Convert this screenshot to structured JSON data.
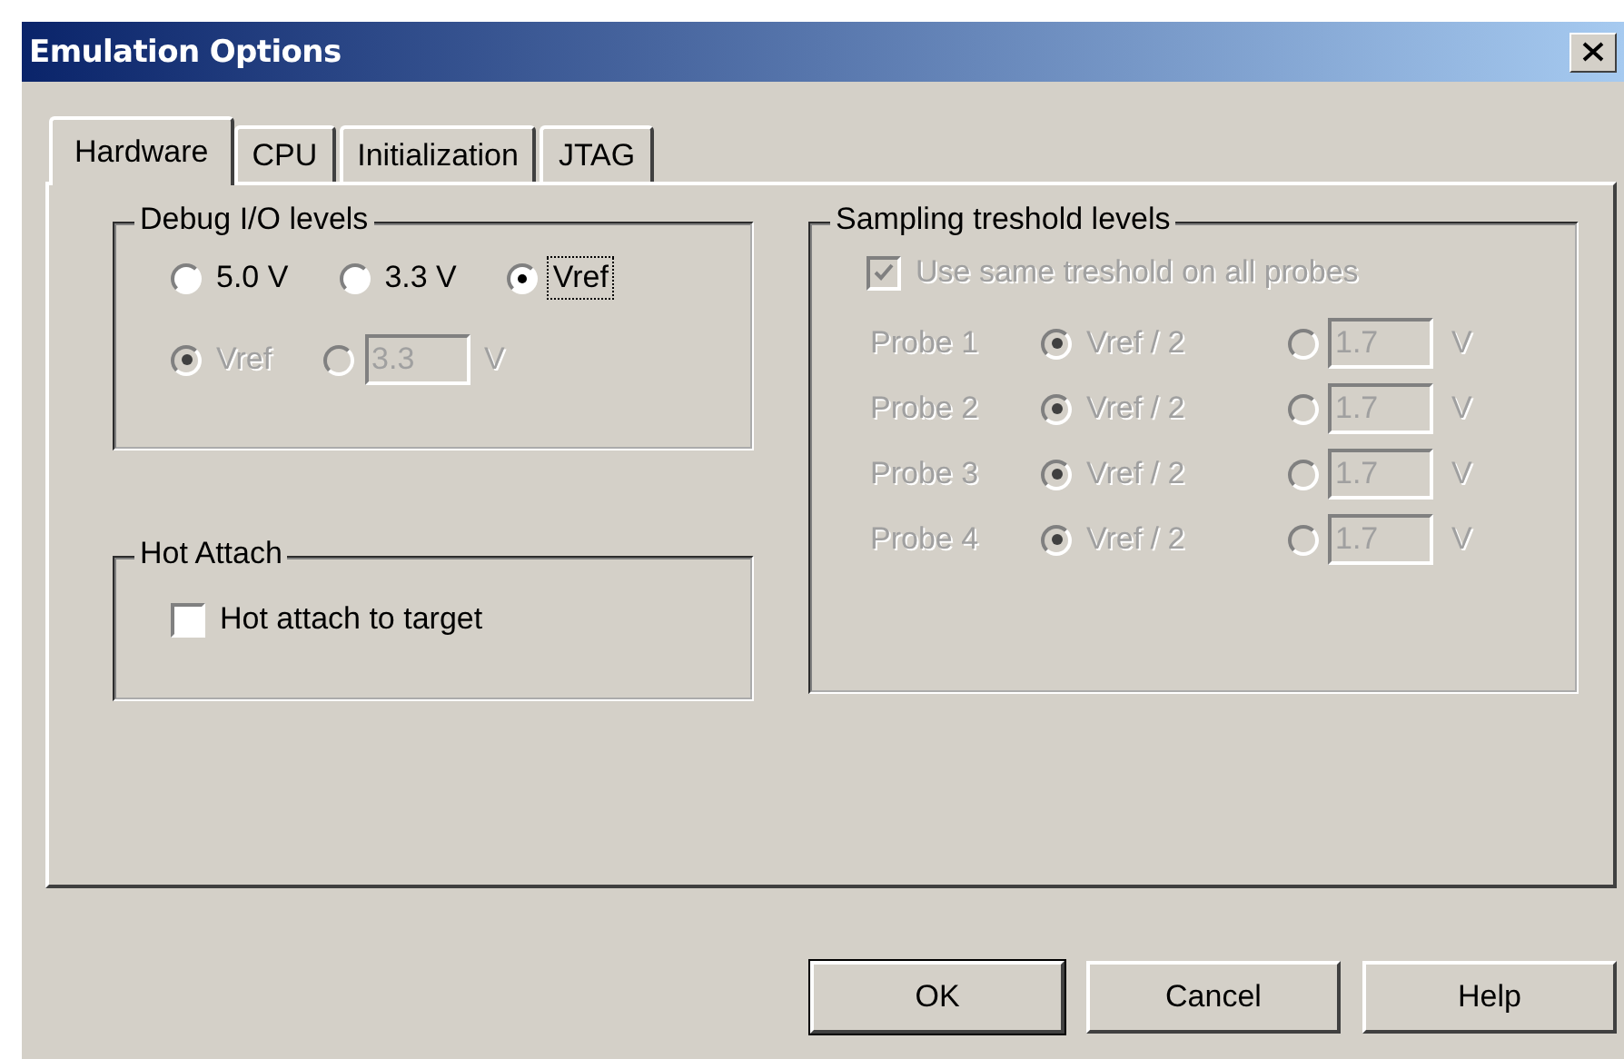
{
  "window": {
    "title": "Emulation Options"
  },
  "tabs": [
    {
      "label": "Hardware",
      "selected": true
    },
    {
      "label": "CPU",
      "selected": false
    },
    {
      "label": "Initialization",
      "selected": false
    },
    {
      "label": "JTAG",
      "selected": false
    }
  ],
  "debug_io": {
    "title": "Debug I/O levels",
    "options": [
      {
        "label": "5.0 V",
        "selected": false,
        "focused": false
      },
      {
        "label": "3.3 V",
        "selected": false,
        "focused": false
      },
      {
        "label": "Vref",
        "selected": true,
        "focused": true
      }
    ],
    "reference": [
      {
        "kind": "radio",
        "label": "Vref",
        "selected": true,
        "disabled": true
      },
      {
        "kind": "field",
        "value": "3.3",
        "unit": "V",
        "selected": false,
        "disabled": true
      }
    ]
  },
  "hot_attach": {
    "title": "Hot Attach",
    "checkbox": {
      "label": "Hot attach to target",
      "checked": false
    }
  },
  "sampling": {
    "title": "Sampling treshold levels",
    "same_threshold": {
      "label": "Use same treshold on all probes",
      "checked": true,
      "disabled": true
    },
    "probes": [
      {
        "label": "Probe 1",
        "vref_label": "Vref / 2",
        "vref_selected": true,
        "value": "1.7",
        "unit": "V",
        "disabled": true
      },
      {
        "label": "Probe 2",
        "vref_label": "Vref / 2",
        "vref_selected": true,
        "value": "1.7",
        "unit": "V",
        "disabled": true
      },
      {
        "label": "Probe 3",
        "vref_label": "Vref / 2",
        "vref_selected": true,
        "value": "1.7",
        "unit": "V",
        "disabled": true
      },
      {
        "label": "Probe 4",
        "vref_label": "Vref / 2",
        "vref_selected": true,
        "value": "1.7",
        "unit": "V",
        "disabled": true
      }
    ]
  },
  "buttons": [
    {
      "label": "OK",
      "default": true
    },
    {
      "label": "Cancel",
      "default": false
    },
    {
      "label": "Help",
      "default": false
    }
  ]
}
